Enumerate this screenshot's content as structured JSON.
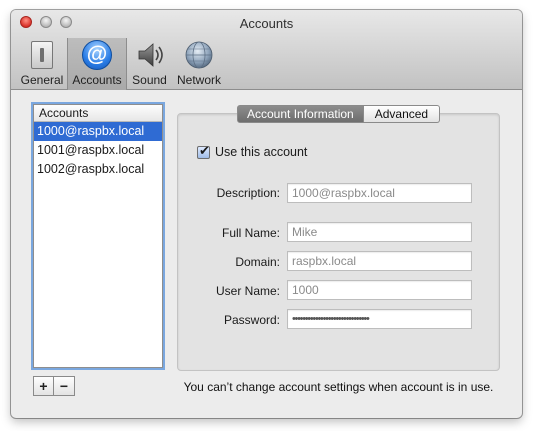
{
  "window": {
    "title": "Accounts"
  },
  "toolbar": {
    "items": [
      {
        "label": "General",
        "icon": "general-switch-icon"
      },
      {
        "label": "Accounts",
        "icon": "at-sign-icon"
      },
      {
        "label": "Sound",
        "icon": "speaker-icon"
      },
      {
        "label": "Network",
        "icon": "globe-icon"
      }
    ],
    "selected": "Accounts"
  },
  "accounts_list": {
    "header": "Accounts",
    "items": [
      "1000@raspbx.local",
      "1001@raspbx.local",
      "1002@raspbx.local"
    ],
    "selected_index": 0,
    "add_label": "+",
    "remove_label": "−"
  },
  "tabs": {
    "items": [
      "Account Information",
      "Advanced"
    ],
    "active": "Account Information"
  },
  "form": {
    "use_account_label": "Use this account",
    "use_account_checked": true,
    "description": {
      "label": "Description:",
      "value": "1000@raspbx.local"
    },
    "full_name": {
      "label": "Full Name:",
      "value": "Mike"
    },
    "domain": {
      "label": "Domain:",
      "value": "raspbx.local"
    },
    "user_name": {
      "label": "User Name:",
      "value": "1000"
    },
    "password": {
      "label": "Password:",
      "value": "••••••••••••••••••••••••••••••"
    }
  },
  "footnote": "You can’t change account settings when account is in use.",
  "colors": {
    "selection": "#2f6bd3",
    "focus_ring": "#7aa7df",
    "close_button": "#d9322a"
  }
}
